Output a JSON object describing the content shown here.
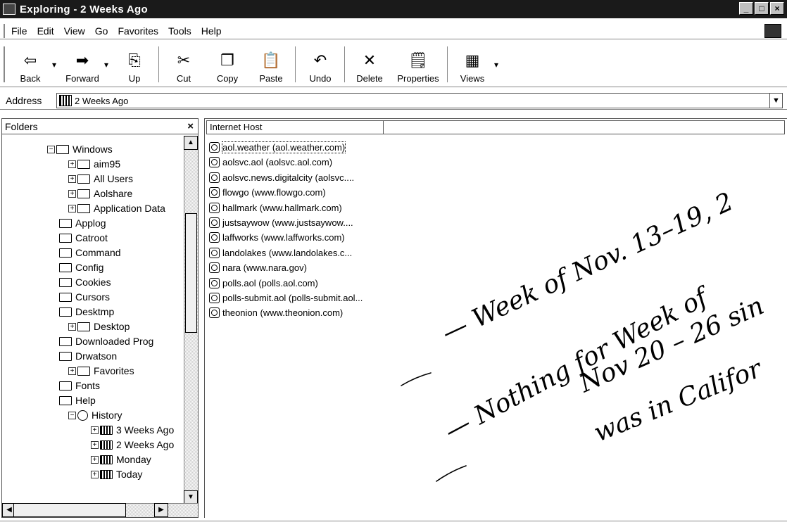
{
  "window": {
    "title": "Exploring - 2 Weeks Ago"
  },
  "menu": [
    "File",
    "Edit",
    "View",
    "Go",
    "Favorites",
    "Tools",
    "Help"
  ],
  "toolbar": {
    "back": "Back",
    "forward": "Forward",
    "up": "Up",
    "cut": "Cut",
    "copy": "Copy",
    "paste": "Paste",
    "undo": "Undo",
    "delete": "Delete",
    "properties": "Properties",
    "views": "Views"
  },
  "address": {
    "label": "Address",
    "value": "2 Weeks Ago"
  },
  "folders": {
    "title": "Folders",
    "close": "×",
    "items": [
      {
        "label": "Windows",
        "exp": "−",
        "depth": 0,
        "icon": "folder"
      },
      {
        "label": "aim95",
        "exp": "+",
        "depth": 1,
        "icon": "folder"
      },
      {
        "label": "All Users",
        "exp": "+",
        "depth": 1,
        "icon": "folder"
      },
      {
        "label": "Aolshare",
        "exp": "+",
        "depth": 1,
        "icon": "folder"
      },
      {
        "label": "Application Data",
        "exp": "+",
        "depth": 1,
        "icon": "folder"
      },
      {
        "label": "Applog",
        "exp": "",
        "depth": 1,
        "icon": "folder"
      },
      {
        "label": "Catroot",
        "exp": "",
        "depth": 1,
        "icon": "folder"
      },
      {
        "label": "Command",
        "exp": "",
        "depth": 1,
        "icon": "folder"
      },
      {
        "label": "Config",
        "exp": "",
        "depth": 1,
        "icon": "folder"
      },
      {
        "label": "Cookies",
        "exp": "",
        "depth": 1,
        "icon": "folder"
      },
      {
        "label": "Cursors",
        "exp": "",
        "depth": 1,
        "icon": "folder"
      },
      {
        "label": "Desktmp",
        "exp": "",
        "depth": 1,
        "icon": "folder"
      },
      {
        "label": "Desktop",
        "exp": "+",
        "depth": 1,
        "icon": "folder"
      },
      {
        "label": "Downloaded Prog",
        "exp": "",
        "depth": 1,
        "icon": "folder"
      },
      {
        "label": "Drwatson",
        "exp": "",
        "depth": 1,
        "icon": "folder"
      },
      {
        "label": "Favorites",
        "exp": "+",
        "depth": 1,
        "icon": "folder"
      },
      {
        "label": "Fonts",
        "exp": "",
        "depth": 1,
        "icon": "folder"
      },
      {
        "label": "Help",
        "exp": "",
        "depth": 1,
        "icon": "folder"
      },
      {
        "label": "History",
        "exp": "−",
        "depth": 1,
        "icon": "hist"
      },
      {
        "label": "3 Weeks Ago",
        "exp": "+",
        "depth": 2,
        "icon": "spec"
      },
      {
        "label": "2 Weeks Ago",
        "exp": "+",
        "depth": 2,
        "icon": "spec"
      },
      {
        "label": "Monday",
        "exp": "+",
        "depth": 2,
        "icon": "spec"
      },
      {
        "label": "Today",
        "exp": "+",
        "depth": 2,
        "icon": "spec"
      }
    ]
  },
  "list": {
    "column": "Internet Host",
    "rows": [
      "aol.weather (aol.weather.com)",
      "aolsvc.aol (aolsvc.aol.com)",
      "aolsvc.news.digitalcity (aolsvc....",
      "flowgo (www.flowgo.com)",
      "hallmark (www.hallmark.com)",
      "justsaywow (www.justsaywow....",
      "laffworks (www.laffworks.com)",
      "landolakes (www.landolakes.c...",
      "nara (www.nara.gov)",
      "polls.aol (polls.aol.com)",
      "polls-submit.aol (polls-submit.aol...",
      "theonion (www.theonion.com)"
    ]
  },
  "note": {
    "line1": "— Week of Nov. 13–19, 2",
    "line2": "— Nothing for Week of",
    "line3": "Nov 20 – 26 sin",
    "line4": "was in Califor"
  }
}
